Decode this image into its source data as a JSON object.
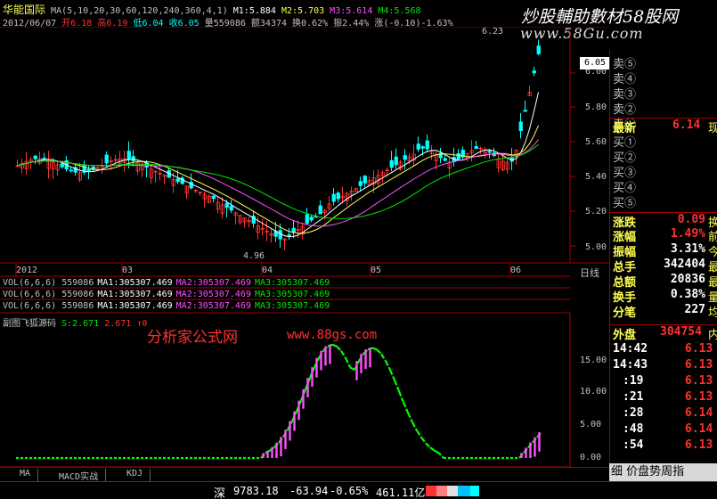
{
  "header": {
    "stock_name": "华能国际",
    "ma_params": "MA(5,10,20,30,60,120,240,360,4,1)",
    "m1": "M1:5.884",
    "m2": "M2:5.703",
    "m3": "M3:5.614",
    "m4": "M4:5.568",
    "date": "2012/06/07",
    "open": "开6.18",
    "high": "高6.19",
    "low": "低6.04",
    "close": "收6.05",
    "volume": "量559086",
    "amount": "额34374",
    "turnover": "换0.62%",
    "amplitude": "振2.44%",
    "change": "涨(-0.10)-1.63%"
  },
  "watermark": {
    "title": "炒股輔助數材58股网",
    "url": "www.58Gu.com",
    "formula_site": "分析家公式网",
    "formula_url": "www.88gs.com"
  },
  "main_chart": {
    "price_labels": [
      "6.00",
      "5.80",
      "5.60",
      "5.40",
      "5.20",
      "5.00"
    ],
    "high_marker": "6.23",
    "low_marker": "4.96",
    "current_price": "6.05",
    "date_labels": [
      "2012",
      "03",
      "04",
      "05",
      "06"
    ],
    "period_label": "日线"
  },
  "volume_lines": [
    {
      "vol": "VOL(6,6,6) 559086",
      "ma1": "MA1:305307.469",
      "ma2": "MA2:305307.469",
      "ma3": "MA3:305307.469"
    },
    {
      "vol": "VOL(6,6,6) 559086",
      "ma1": "MA1:305307.469",
      "ma2": "MA2:305307.469",
      "ma3": "MA3:305307.469"
    },
    {
      "vol": "VOL(6,6,6) 559086",
      "ma1": "MA1:305307.469",
      "ma2": "MA2:305307.469",
      "ma3": "MA3:305307.469"
    }
  ],
  "sub_chart": {
    "title": "副图飞狐源码",
    "s": "S:2.671",
    "val2": "2.671",
    "arrow": "↑0",
    "axis_labels": [
      "15.00",
      "10.00",
      "5.00",
      "0.00"
    ]
  },
  "order_book": {
    "sell": [
      "卖⑤",
      "卖④",
      "卖③",
      "卖②",
      "卖①"
    ],
    "latest_label": "最新",
    "latest_value": "6.14",
    "latest_suffix": "现",
    "buy": [
      "买①",
      "买②",
      "买③",
      "买④",
      "买⑤"
    ]
  },
  "quote_stats": [
    {
      "label": "涨跌",
      "value": "0.09",
      "suffix": "换"
    },
    {
      "label": "涨幅",
      "value": "1.49%",
      "suffix": "前"
    },
    {
      "label": "振幅",
      "value": "3.31%",
      "suffix": "今"
    },
    {
      "label": "总手",
      "value": "342404",
      "suffix": "最"
    },
    {
      "label": "总额",
      "value": "20836",
      "suffix": "最"
    },
    {
      "label": "换手",
      "value": "0.38%",
      "suffix": "量"
    },
    {
      "label": "分笔",
      "value": "227",
      "suffix": "均"
    }
  ],
  "outer_disc": {
    "label": "外盘",
    "value": "304754",
    "suffix": "内"
  },
  "ticks": [
    {
      "time": "14:42",
      "price": "6.13"
    },
    {
      "time": "14:43",
      "price": "6.13"
    },
    {
      "time": ":19",
      "price": "6.13"
    },
    {
      "time": ":21",
      "price": "6.13"
    },
    {
      "time": ":28",
      "price": "6.14"
    },
    {
      "time": ":48",
      "price": "6.14"
    },
    {
      "time": ":54",
      "price": "6.13"
    }
  ],
  "bottom_tabs": [
    "MA",
    "MACD实战",
    "KDJ"
  ],
  "bottom_right_tabs": "细  价盘势周指",
  "status_bar": {
    "market": "深",
    "index": "9783.18",
    "change": "-63.94",
    "pct": "-0.65%",
    "amount": "461.11亿"
  },
  "colors": {
    "up": "#ff3232",
    "down": "#00ffff",
    "ma_white": "#ffffff",
    "ma_yellow": "#ffff54",
    "ma_magenta": "#ff50ff",
    "ma_green": "#00e600",
    "grid_red": "#a00000"
  },
  "chart_data": {
    "type": "candlestick",
    "price_range": [
      4.9,
      6.25
    ],
    "indicator": {
      "name": "副图飞狐源码",
      "range": [
        0,
        18
      ],
      "peaks": [
        {
          "date_index": 36,
          "value": 17.5
        },
        {
          "date_index": 45,
          "value": 17.0
        }
      ]
    }
  }
}
